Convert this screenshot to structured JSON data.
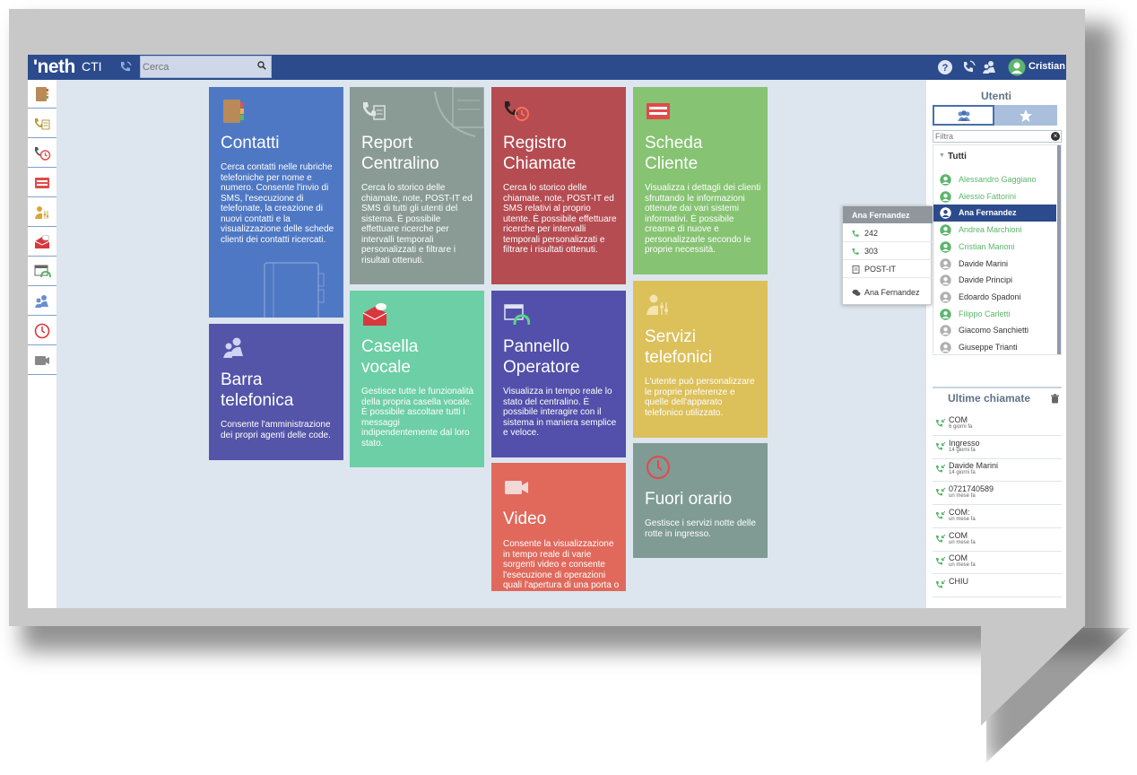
{
  "app": {
    "logo": "'neth",
    "logo_suffix": "CTI",
    "search_placeholder": "Cerca",
    "user_name": "Cristian"
  },
  "tiles": {
    "contatti": {
      "title": "Contatti",
      "desc": "Cerca contatti nelle rubriche telefoniche per nome e numero. Consente l'invio di SMS, l'esecuzione di telefonate, la creazione di nuovi contatti e la visualizzazione delle schede clienti dei contatti ricercati.",
      "color": "#4f78c4"
    },
    "report": {
      "title": "Report\nCentralino",
      "desc": "Cerca lo storico delle chiamate, note, POST-IT ed SMS di tutti gli utenti del sistema. È possibile effettuare ricerche per intervalli temporali personalizzati e filtrare i risultati ottenuti.",
      "color": "#8a9b95"
    },
    "registro": {
      "title": "Registro\nChiamate",
      "desc": "Cerca lo storico delle chiamate, note, POST-IT ed SMS relativi al proprio utente. È possibile effettuare ricerche per intervalli temporali personalizzati e filtrare i risultati ottenuti.",
      "color": "#b54c52"
    },
    "scheda": {
      "title": "Scheda\nCliente",
      "desc": "Visualizza i dettagli dei clienti sfruttando le informazioni ottenute dai vari sistemi informativi. È possibile crearne di nuove e personalizzarle secondo le proprie necessità.",
      "color": "#86c372"
    },
    "barra": {
      "title": "Barra\ntelefonica",
      "desc": "Consente l'amministrazione dei propri agenti delle code.",
      "color": "#5454a9"
    },
    "casella": {
      "title": "Casella\nvocale",
      "desc": "Gestisce tutte le funzionalità della propria casella vocale. È possibile ascoltare tutti i messaggi indipendentemente dal loro stato.",
      "color": "#6dcfa5"
    },
    "pannello": {
      "title": "Pannello\nOperatore",
      "desc": "Visualizza in tempo reale lo stato del centralino. È possibile interagire con il sistema in maniera semplice e veloce.",
      "color": "#5250aa"
    },
    "servizi": {
      "title": "Servizi\ntelefonici",
      "desc": "L'utente può personalizzare le proprie preferenze e quelle dell'apparato telefonico utilizzato.",
      "color": "#dcc05a"
    },
    "video": {
      "title": "Video",
      "desc": "Consente la visualizzazione in tempo reale di varie sorgenti video e consente l'esecuzione di operazioni quali l'apertura di una porta o di un cancello.",
      "color": "#e0695c"
    },
    "fuori": {
      "title": "Fuori orario",
      "desc": "Gestisce i servizi notte delle rotte in ingresso.",
      "color": "#7f9b94"
    }
  },
  "users": {
    "title": "Utenti",
    "filter_placeholder": "Filtra",
    "group": "Tutti",
    "list": [
      {
        "name": "Alessandro Gaggiano",
        "status": "online"
      },
      {
        "name": "Alessio Fattorini",
        "status": "online"
      },
      {
        "name": "Ana Fernandez",
        "status": "selected"
      },
      {
        "name": "Andrea Marchioni",
        "status": "online"
      },
      {
        "name": "Cristian Manoni",
        "status": "online"
      },
      {
        "name": "Davide Marini",
        "status": "offline"
      },
      {
        "name": "Davide Principi",
        "status": "offline"
      },
      {
        "name": "Edoardo Spadoni",
        "status": "offline"
      },
      {
        "name": "Filippo Carletti",
        "status": "online"
      },
      {
        "name": "Giacomo Sanchietti",
        "status": "offline"
      },
      {
        "name": "Giuseppe Trianti",
        "status": "offline"
      }
    ]
  },
  "popup": {
    "title": "Ana Fernandez",
    "rows": [
      {
        "icon": "phone-icon",
        "text": "242"
      },
      {
        "icon": "phone-icon",
        "text": "303"
      },
      {
        "icon": "post-it-icon",
        "text": "POST-IT"
      },
      {
        "icon": "chat-icon",
        "text": "Ana Fernandez"
      }
    ]
  },
  "recent": {
    "title": "Ultime chiamate",
    "calls": [
      {
        "name": "COM",
        "time": "6 giorni fa"
      },
      {
        "name": "Ingresso",
        "time": "14 giorni fa"
      },
      {
        "name": "Davide Marini",
        "time": "14 giorni fa"
      },
      {
        "name": "0721740589",
        "time": "un mese fa"
      },
      {
        "name": "COM:",
        "time": "un mese fa"
      },
      {
        "name": "COM",
        "time": "un mese fa"
      },
      {
        "name": "COM",
        "time": "un mese fa"
      },
      {
        "name": "CHIU",
        "time": ""
      }
    ]
  },
  "colors": {
    "topbar": "#2c4b8d",
    "online": "#5bb66b",
    "offline": "#b0b0b0",
    "selected_bg": "#2c4b8d"
  }
}
